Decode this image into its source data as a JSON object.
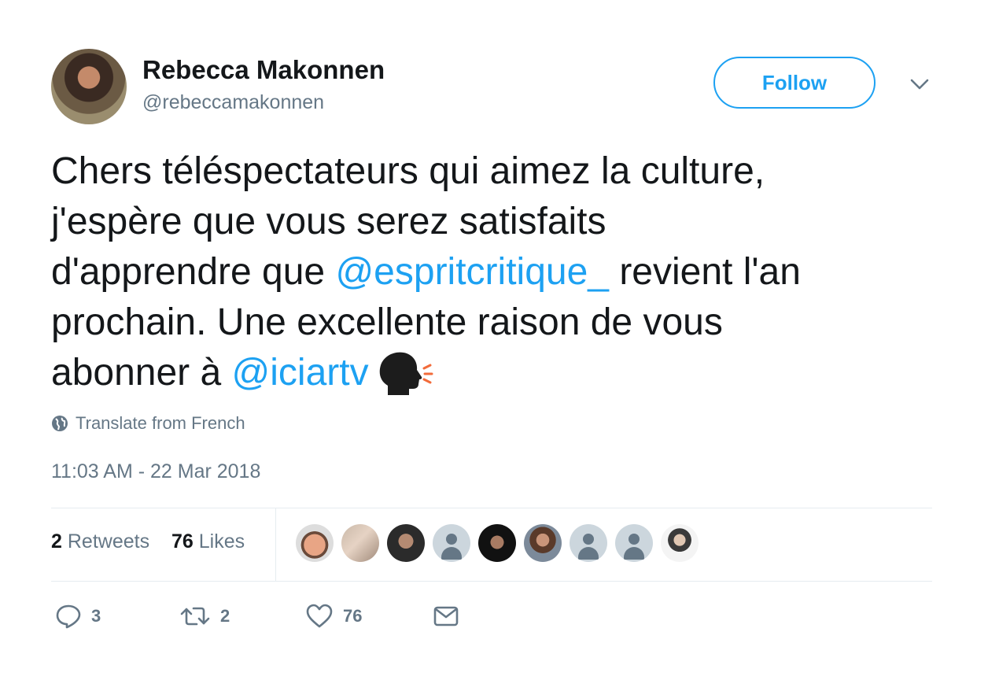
{
  "author": {
    "name": "Rebecca Makonnen",
    "handle": "@rebeccamakonnen"
  },
  "follow_label": "Follow",
  "tweet": {
    "line1": "Chers téléspectateurs qui aimez la culture,",
    "line2": "j'espère que vous serez satisfaits",
    "line3_a": "d'apprendre que ",
    "line3_mention": "@espritcritique_",
    "line3_b": " revient l'an",
    "line4": "prochain. Une excellente raison de vous",
    "line5_a": "abonner à ",
    "line5_mention": "@iciartv",
    "emoji": "speaking-head-emoji"
  },
  "translate_label": "Translate from French",
  "timestamp": "11:03 AM - 22 Mar 2018",
  "stats": {
    "retweets_count": "2",
    "retweets_label": "Retweets",
    "likes_count": "76",
    "likes_label": "Likes"
  },
  "liked_by_avatars": 9,
  "actions": {
    "replies": "3",
    "retweets": "2",
    "likes": "76"
  },
  "colors": {
    "accent": "#1da1f2",
    "text": "#14171a",
    "muted": "#657786",
    "divider": "#e6ecf0"
  }
}
